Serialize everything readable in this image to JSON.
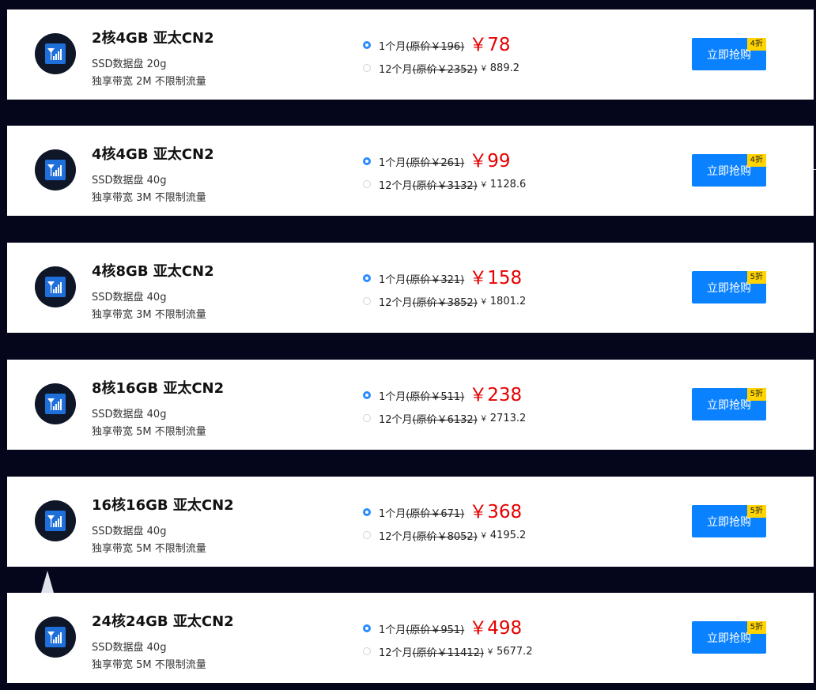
{
  "colors": {
    "background": "#05061c",
    "card": "#ffffff",
    "accent": "#0a82ff",
    "price": "#e60000",
    "badge": "#ffd400"
  },
  "plans": [
    {
      "title": "2核4GB 亚太CN2",
      "disk": "SSD数据盘 20g",
      "bandwidth": "独享带宽 2M 不限制流量",
      "monthly": {
        "period": "1个月",
        "original": "(原价￥196)",
        "price": "￥78",
        "selected": true
      },
      "yearly": {
        "period": "12个月",
        "original": "(原价￥2352)",
        "currency": "￥",
        "price": "889.2",
        "selected": false
      },
      "buy_label": "立即抢购",
      "badge": "4折",
      "icon": "signal-icon"
    },
    {
      "title": "4核4GB 亚太CN2",
      "disk": "SSD数据盘 40g",
      "bandwidth": "独享带宽 3M 不限制流量",
      "monthly": {
        "period": "1个月",
        "original": "(原价￥261)",
        "price": "￥99",
        "selected": true
      },
      "yearly": {
        "period": "12个月",
        "original": "(原价￥3132)",
        "currency": "￥",
        "price": "1128.6",
        "selected": false
      },
      "buy_label": "立即抢购",
      "badge": "4折",
      "icon": "signal-icon"
    },
    {
      "title": "4核8GB 亚太CN2",
      "disk": "SSD数据盘 40g",
      "bandwidth": "独享带宽 3M 不限制流量",
      "monthly": {
        "period": "1个月",
        "original": "(原价￥321)",
        "price": "￥158",
        "selected": true
      },
      "yearly": {
        "period": "12个月",
        "original": "(原价￥3852)",
        "currency": "￥",
        "price": "1801.2",
        "selected": false
      },
      "buy_label": "立即抢购",
      "badge": "5折",
      "icon": "signal-icon"
    },
    {
      "title": "8核16GB 亚太CN2",
      "disk": "SSD数据盘 40g",
      "bandwidth": "独享带宽 5M 不限制流量",
      "monthly": {
        "period": "1个月",
        "original": "(原价￥511)",
        "price": "￥238",
        "selected": true
      },
      "yearly": {
        "period": "12个月",
        "original": "(原价￥6132)",
        "currency": "￥",
        "price": "2713.2",
        "selected": false
      },
      "buy_label": "立即抢购",
      "badge": "5折",
      "icon": "signal-icon"
    },
    {
      "title": "16核16GB 亚太CN2",
      "disk": "SSD数据盘 40g",
      "bandwidth": "独享带宽 5M 不限制流量",
      "monthly": {
        "period": "1个月",
        "original": "(原价￥671)",
        "price": "￥368",
        "selected": true
      },
      "yearly": {
        "period": "12个月",
        "original": "(原价￥8052)",
        "currency": "￥",
        "price": "4195.2",
        "selected": false
      },
      "buy_label": "立即抢购",
      "badge": "5折",
      "icon": "signal-icon"
    },
    {
      "title": "24核24GB 亚太CN2",
      "disk": "SSD数据盘 40g",
      "bandwidth": "独享带宽 5M 不限制流量",
      "monthly": {
        "period": "1个月",
        "original": "(原价￥951)",
        "price": "￥498",
        "selected": true
      },
      "yearly": {
        "period": "12个月",
        "original": "(原价￥11412)",
        "currency": "￥",
        "price": "5677.2",
        "selected": false
      },
      "buy_label": "立即抢购",
      "badge": "5折",
      "icon": "signal-icon"
    }
  ]
}
